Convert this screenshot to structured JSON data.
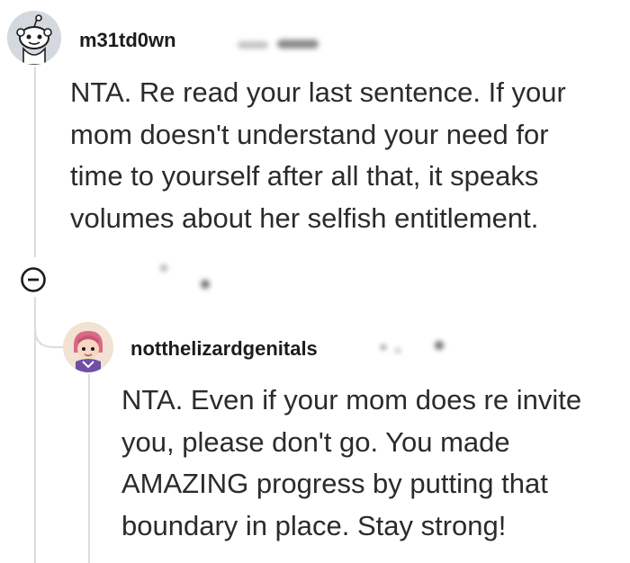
{
  "comments": [
    {
      "username": "m31td0wn",
      "body_lines": [
        "NTA. Re read your last sentence. If your",
        "mom doesn't understand your need for",
        "time to yourself after all that, it speaks",
        "volumes about her selfish entitlement."
      ]
    },
    {
      "username": "notthelizardgenitals",
      "body_lines": [
        "NTA. Even if your mom does re invite",
        "you, please don't go. You made",
        "AMAZING progress by putting that",
        "boundary in place. Stay strong!"
      ]
    }
  ],
  "icons": {
    "collapse": "collapse-minus-icon",
    "avatar_1": "snoo-avatar-icon",
    "avatar_2": "cartoon-avatar-icon"
  }
}
